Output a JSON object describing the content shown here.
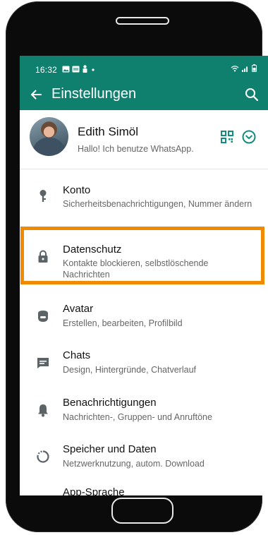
{
  "status_bar": {
    "time": "16:32",
    "icons": [
      "image-icon",
      "calendar-icon",
      "person-icon",
      "dot-icon"
    ],
    "right_icons": [
      "wifi-icon",
      "signal-icon",
      "battery-icon"
    ]
  },
  "app_bar": {
    "title": "Einstellungen",
    "back_icon": "arrow-left-icon",
    "search_icon": "search-icon"
  },
  "profile": {
    "name": "Edith Simöl",
    "status": "Hallo! Ich benutze WhatsApp.",
    "qr_icon": "qr-code-icon",
    "dropdown_icon": "chevron-down-circle-icon"
  },
  "settings": [
    {
      "id": "konto",
      "label": "Konto",
      "desc": "Sicherheitsbenachrichtigungen, Nummer ändern",
      "icon": "key-icon"
    },
    {
      "id": "datenschutz",
      "label": "Datenschutz",
      "desc": "Kontakte blockieren, selbstlöschende Nachrichten",
      "icon": "lock-icon",
      "highlighted": true
    },
    {
      "id": "avatar",
      "label": "Avatar",
      "desc": "Erstellen, bearbeiten, Profilbild",
      "icon": "avatar-face-icon"
    },
    {
      "id": "chats",
      "label": "Chats",
      "desc": "Design, Hintergründe, Chatverlauf",
      "icon": "chat-icon"
    },
    {
      "id": "benachrichtigungen",
      "label": "Benachrichtigungen",
      "desc": "Nachrichten-, Gruppen- und Anruftöne",
      "icon": "bell-icon"
    },
    {
      "id": "speicher",
      "label": "Speicher und Daten",
      "desc": "Netzwerknutzung, autom. Download",
      "icon": "storage-circle-icon"
    },
    {
      "id": "sprache",
      "label": "App-Sprache",
      "desc": "",
      "icon": "globe-icon"
    }
  ],
  "colors": {
    "header": "#0f7f6e",
    "accent": "#128c7e",
    "highlight": "#f08a00"
  }
}
